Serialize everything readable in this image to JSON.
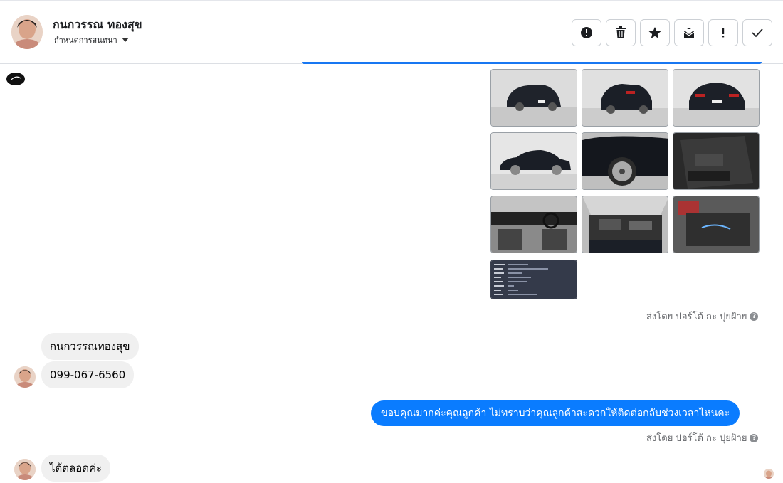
{
  "header": {
    "contact_name": "กนกวรรณ ทองสุข",
    "assign_label": "กำหนดการสนทนา",
    "actions": [
      {
        "name": "spam-button",
        "icon": "alert-circle-icon"
      },
      {
        "name": "delete-button",
        "icon": "trash-icon"
      },
      {
        "name": "star-button",
        "icon": "star-icon"
      },
      {
        "name": "mark-unread-button",
        "icon": "envelope-icon"
      },
      {
        "name": "important-button",
        "icon": "exclamation-icon"
      },
      {
        "name": "done-button",
        "icon": "check-icon"
      }
    ]
  },
  "conversation": {
    "image_grid": {
      "count": 10,
      "sent_by": "ส่งโดย ปอร์โต้ กะ ปุยฝ้าย"
    },
    "messages": [
      {
        "side": "in",
        "text": "กนกวรรณทองสุข"
      },
      {
        "side": "in",
        "text": "099-067-6560"
      },
      {
        "side": "out",
        "text": "ขอบคุณมากค่ะคุณลูกค้า ไม่ทราบว่าคุณลูกค้าสะดวกให้ติดต่อกลับช่วงเวลาไหนคะ",
        "sent_by": "ส่งโดย ปอร์โต้ กะ ปุยฝ้าย"
      },
      {
        "side": "in",
        "text": "ได้ตลอดค่ะ"
      }
    ],
    "help_glyph": "?"
  },
  "colors": {
    "accent": "#1877f2",
    "outgoing_bubble": "#0a7cff",
    "incoming_bubble": "#f0f0f0"
  }
}
